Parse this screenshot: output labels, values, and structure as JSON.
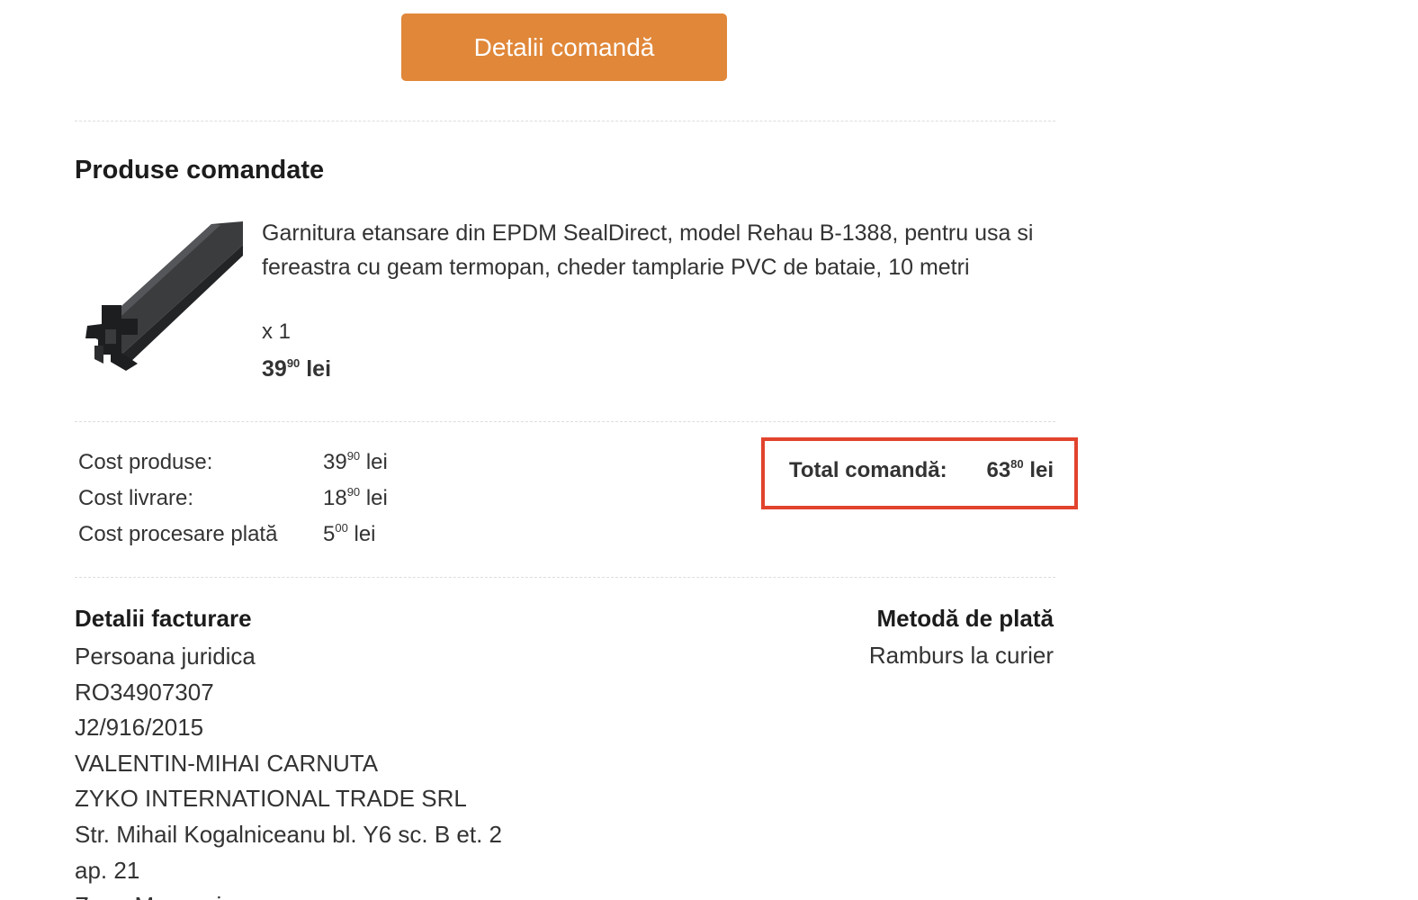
{
  "header": {
    "details_button_label": "Detalii comandă"
  },
  "products": {
    "section_title": "Produse comandate",
    "items": [
      {
        "description": "Garnitura etansare din EPDM SealDirect, model Rehau B-1388, pentru usa si fereastra cu geam termopan, cheder tamplarie PVC de bataie, 10 metri",
        "quantity": "x 1",
        "price_int": "39",
        "price_dec": "90",
        "currency": "lei",
        "image_icon": "rubber-seal-profile-image"
      }
    ]
  },
  "costs": {
    "rows": [
      {
        "label": "Cost produse:",
        "int": "39",
        "dec": "90",
        "currency": "lei"
      },
      {
        "label": "Cost livrare:",
        "int": "18",
        "dec": "90",
        "currency": "lei"
      },
      {
        "label": "Cost procesare plată",
        "int": "5",
        "dec": "00",
        "currency": "lei"
      }
    ],
    "total": {
      "label": "Total comandă:",
      "int": "63",
      "dec": "80",
      "currency": "lei",
      "highlight_color": "#e2432d"
    }
  },
  "billing": {
    "title": "Detalii facturare",
    "lines": [
      "Persoana juridica",
      "RO34907307",
      "J2/916/2015",
      "VALENTIN-MIHAI CARNUTA",
      "ZYKO INTERNATIONAL TRADE SRL",
      "Str. Mihail Kogalniceanu bl. Y6 sc. B et. 2",
      "ap. 21",
      "Zona Macaveiu"
    ]
  },
  "payment": {
    "title": "Metodă de plată",
    "method": "Ramburs la curier"
  },
  "colors": {
    "accent_button": "#e08739",
    "total_border": "#e2432d"
  }
}
